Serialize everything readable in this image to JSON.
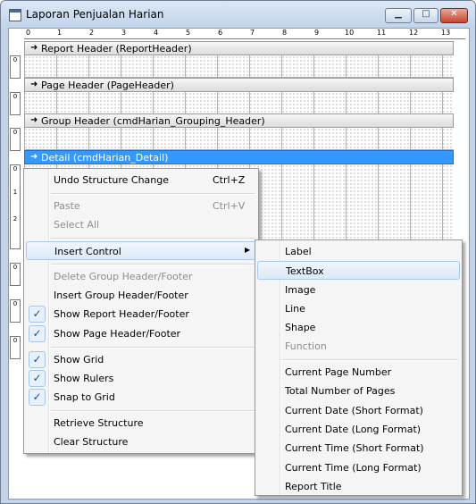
{
  "window": {
    "title": "Laporan Penjualan Harian",
    "minimize_icon": "minimize-icon",
    "maximize_icon": "maximize-icon",
    "close_icon": "close-icon",
    "minimize_glyph": "▁",
    "maximize_glyph": "□",
    "close_glyph": "✕"
  },
  "ruler": {
    "ticks": [
      "0",
      "1",
      "2",
      "3",
      "4",
      "5",
      "6",
      "7",
      "8",
      "9",
      "10",
      "11",
      "12",
      "13"
    ],
    "side_zero": "0",
    "side_one": "1",
    "side_two": "2"
  },
  "sections": {
    "report_header": "Report Header (ReportHeader)",
    "page_header": "Page Header (PageHeader)",
    "group_header": "Group Header (cmdHarian_Grouping_Header)",
    "detail": "Detail (cmdHarian_Detail)",
    "arrow_glyph": "➜"
  },
  "context_menu": {
    "undo": {
      "label": "Undo Structure Change",
      "shortcut": "Ctrl+Z"
    },
    "paste": {
      "label": "Paste",
      "shortcut": "Ctrl+V"
    },
    "select_all": "Select All",
    "insert_control": "Insert Control",
    "delete_group": "Delete Group Header/Footer",
    "insert_group": "Insert Group Header/Footer",
    "show_report_hf": "Show Report Header/Footer",
    "show_page_hf": "Show Page Header/Footer",
    "show_grid": "Show Grid",
    "show_rulers": "Show Rulers",
    "snap_to_grid": "Snap to Grid",
    "retrieve": "Retrieve Structure",
    "clear": "Clear Structure",
    "check_glyph": "✓",
    "arrow_glyph": "▶"
  },
  "submenu": {
    "label": "Label",
    "textbox": "TextBox",
    "image": "Image",
    "line": "Line",
    "shape": "Shape",
    "function": "Function",
    "current_page_number": "Current Page Number",
    "total_pages": "Total Number of Pages",
    "date_short": "Current Date (Short Format)",
    "date_long": "Current Date (Long Format)",
    "time_short": "Current Time (Short Format)",
    "time_long": "Current Time (Long Format)",
    "report_title": "Report Title"
  }
}
